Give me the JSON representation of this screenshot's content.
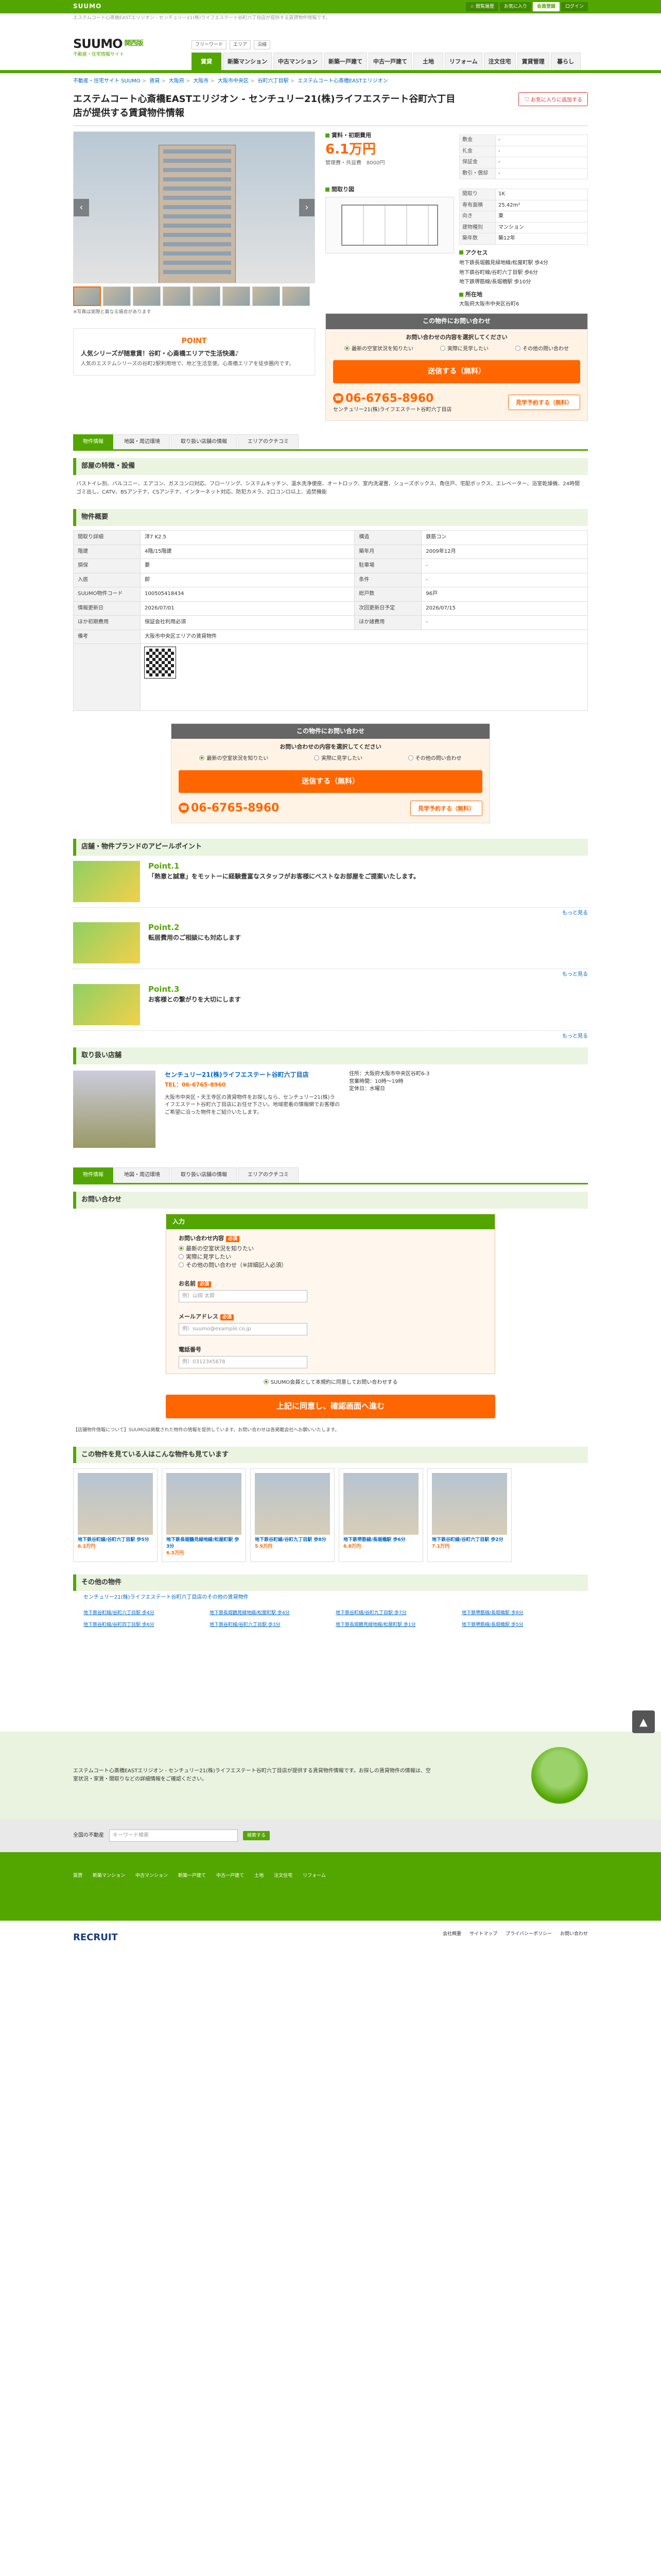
{
  "topbar": {
    "logo": "SUUMO",
    "links": [
      "☆ 閲覧履歴",
      "お気に入り",
      "会員登録",
      "ログイン"
    ]
  },
  "tagline": "エステムコート心斎橋EASTエリジオン - センチュリー21(株)ライフエステート谷町六丁目店が提供する賃貸物件情報です。",
  "header": {
    "logo": "SUUMO",
    "logo_sub": "不動産・住宅情報サイト",
    "area": "関西版",
    "search": [
      "フリーワード",
      "エリア",
      "沿線"
    ],
    "nav": [
      "賃貸",
      "新築マンション",
      "中古マンション",
      "新築一戸建て",
      "中古一戸建て",
      "土地",
      "リフォーム",
      "注文住宅",
      "賃貸管理",
      "暮らし"
    ]
  },
  "breadcrumb": [
    "不動産・住宅サイト SUUMO",
    "賃貸",
    "大阪府",
    "大阪市",
    "大阪市中央区",
    "谷町六丁目駅",
    "エステムコート心斎橋EASTエリジオン"
  ],
  "page_title": "エステムコート心斎橋EASTエリジオン - センチュリー21(株)ライフエステート谷町六丁目店が提供する賃貸物件情報",
  "fav_label": "♡ お気に入りに追加する",
  "photo_note": "※写真は実際と異なる場合があります",
  "point": {
    "tag": "POINT",
    "head": "人気シリーズが随意賃！谷町・心斎橋エリアで生活快適♪",
    "body": "人気のエステムシリーズの谷町2駅利用地で、地ど生活至便。心斎橋エリアを徒歩圏内です。"
  },
  "price": {
    "label": "賃料・初期費用",
    "value": "6.1万円",
    "sub": "管理費・共益費　8000円",
    "rows": [
      [
        "敷金",
        "-"
      ],
      [
        "礼金",
        "-"
      ],
      [
        "保証金",
        "-"
      ],
      [
        "敷引・償却",
        "-"
      ]
    ]
  },
  "layout": {
    "label": "間取り図",
    "rows": [
      [
        "間取り",
        "1K"
      ],
      [
        "専有面積",
        "25.42m²"
      ],
      [
        "向き",
        "東"
      ],
      [
        "建物種別",
        "マンション"
      ],
      [
        "築年数",
        "築12年"
      ]
    ]
  },
  "access": {
    "label": "アクセス",
    "items": [
      "地下鉄長堀鶴見緑地線/松屋町駅 歩4分",
      "地下鉄谷町線/谷町六丁目駅 歩6分",
      "地下鉄堺筋線/長堀橋駅 歩10分"
    ],
    "addr_label": "所在地",
    "addr": "大阪府大阪市中央区谷町6"
  },
  "inq": {
    "header": "この物件にお問い合わせ",
    "question": "お問い合わせの内容を選択してください",
    "opts": [
      "最新の空室状況を知りたい",
      "実際に見学したい",
      "その他の問い合わせ"
    ],
    "btn": "送信する（無料）",
    "tel": "06-6765-8960",
    "tel_note": "センチュリー21(株)ライフエステート谷町六丁目店",
    "visit": "見学予約する（無料）"
  },
  "tabs": [
    "物件情報",
    "地図・周辺環境",
    "取り扱い店舗の情報",
    "エリアのクチコミ"
  ],
  "features": {
    "title": "部屋の特徴・設備",
    "body": "バストイレ別、バルコニー、エアコン、ガスコンロ対応、フローリング、システムキッチン、温水洗浄便座、オートロック、室内洗濯置、シューズボックス、角住戸、宅配ボックス、エレベーター、浴室乾燥機、24時間ゴミ出し、CATV、BSアンテナ、CSアンテナ、インターネット対応、防犯カメラ、2口コンロ以上、追焚機能"
  },
  "details": {
    "title": "物件概要",
    "rows": [
      [
        "間取り詳細",
        "洋7 K2.5",
        "構造",
        "鉄筋コン"
      ],
      [
        "階建",
        "4階/15階建",
        "築年月",
        "2009年12月"
      ],
      [
        "損保",
        "要",
        "駐車場",
        "-"
      ],
      [
        "入居",
        "即",
        "条件",
        "-"
      ],
      [
        "SUUMO物件コード",
        "100505418434",
        "総戸数",
        "96戸"
      ],
      [
        "情報更新日",
        "2026/07/01",
        "次回更新日予定",
        "2026/07/15"
      ],
      [
        "ほか初期費用",
        "保証会社利用必須",
        "ほか諸費用",
        "-"
      ],
      [
        "備考",
        "大阪市中央区エリアの賃貸物件",
        "",
        ""
      ]
    ]
  },
  "appeal": {
    "title": "店舗・物件プランドのアピールポイント",
    "items": [
      [
        "Point.1",
        "「熱意と誠意」をモットーに経験豊富なスタッフがお客様にベストなお部屋をご提案いたします。"
      ],
      [
        "Point.2",
        "転居費用のご相談にも対応します"
      ],
      [
        "Point.3",
        "お客様との繋がりを大切にします"
      ]
    ],
    "more": "もっと見る"
  },
  "shop": {
    "title": "取り扱い店舗",
    "name": "センチュリー21(株)ライフエステート谷町六丁目店",
    "tel": "TEL：06-6765-8960",
    "desc": "大阪市中央区・天王寺区の賃貸物件をお探しなら、センチュリー21(株)ライフエステート谷町六丁目店にお任せ下さい。地域密着の情報網でお客様のご希望に沿った物件をご紹介いたします。",
    "info": "住所：大阪府大阪市中央区谷町6-3\n営業時間：10時〜19時\n定休日：水曜日"
  },
  "form": {
    "title": "お問い合わせ",
    "head": "入力",
    "q": "お問い合わせ内容",
    "opts": [
      "最新の空室状況を知りたい",
      "実際に見学したい",
      "その他の問い合わせ（※詳細記入必須）"
    ],
    "name": "お名前",
    "name_ph": "例）山田 太郎",
    "mail": "メールアドレス",
    "mail_ph": "例）suumo@example.co.jp",
    "tel": "電話番号",
    "tel_ph": "例）0312345678",
    "agree": "SUUMO会員として本規約に同意してお問い合わせする",
    "btn": "上記に同意し、確認画面へ進む"
  },
  "notes": "【店舗物件情報について】SUUMOは掲載された物件の情報を提供しています。お問い合わせは各掲載会社へお願いいたします。",
  "recs": {
    "title": "この物件を見ている人はこんな物件も見ています",
    "items": [
      [
        "地下鉄谷町線/谷町六丁目駅 歩5分",
        "6.3万円"
      ],
      [
        "地下鉄長堀鶴見緑地線/松屋町駅 歩3分",
        "6.5万円"
      ],
      [
        "地下鉄谷町線/谷町九丁目駅 歩8分",
        "5.9万円"
      ],
      [
        "地下鉄堺筋線/長堀橋駅 歩6分",
        "6.8万円"
      ],
      [
        "地下鉄谷町線/谷町六丁目駅 歩2分",
        "7.1万円"
      ]
    ]
  },
  "other": {
    "title": "その他の物件",
    "sub": "センチュリー21(株)ライフエステート谷町六丁目店のその他の賃貸物件",
    "items": [
      "地下鉄谷町線/谷町六丁目駅 歩4分",
      "地下鉄長堀鶴見緑地線/松屋町駅 歩4分",
      "地下鉄谷町線/谷町九丁目駅 歩7分",
      "地下鉄堺筋線/長堀橋駅 歩8分",
      "地下鉄谷町線/谷町四丁目駅 歩6分",
      "地下鉄谷町線/谷町六丁目駅 歩3分",
      "地下鉄長堀鶴見緑地線/松屋町駅 歩1分",
      "地下鉄堺筋線/長堀橋駅 歩5分"
    ]
  },
  "banner": "エステムコート心斎橋EASTエリジオン - センチュリー21(株)ライフエステート谷町六丁目店が提供する賃貸物件情報です。お探しの賃貸物件の情報は、空室状況・家賃・間取りなどの詳細情報をご確認ください。",
  "footer": {
    "search_label": "全国の不動産",
    "search_ph": "キーワード検索",
    "search_btn": "検索する",
    "links": [
      "賃貸",
      "新築マンション",
      "中古マンション",
      "新築一戸建て",
      "中古一戸建て",
      "土地",
      "注文住宅",
      "リフォーム"
    ],
    "bottom": [
      "会社概要",
      "サイトマップ",
      "プライバシーポリシー",
      "お問い合わせ"
    ],
    "brand": "RECRUIT"
  }
}
